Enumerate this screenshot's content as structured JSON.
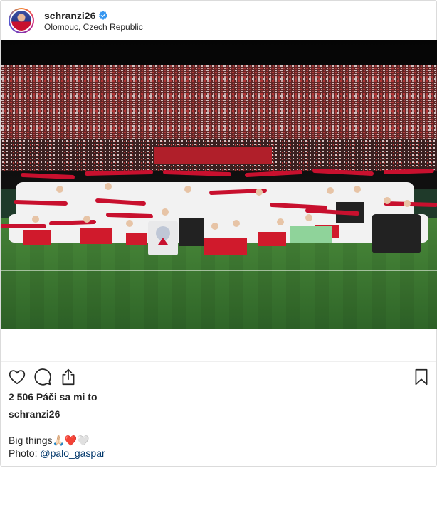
{
  "post": {
    "username": "schranzi26",
    "location": "Olomouc, Czech Republic",
    "likes_text": "2 506 Páči sa mi to",
    "caption_author": "schranzi26",
    "caption_line1": "Big things🙏🏻❤️🤍",
    "caption_photo_label": "Photo: ",
    "caption_mention": "@palo_gaspar"
  },
  "colors": {
    "verified": "#3897f0",
    "mention": "#00376b",
    "border": "#dbdbdb",
    "pitch": "#3f7a32",
    "jersey_red": "#c8102e"
  },
  "icons": [
    "heart-icon",
    "comment-icon",
    "share-icon",
    "bookmark-icon",
    "verified-badge-icon"
  ]
}
